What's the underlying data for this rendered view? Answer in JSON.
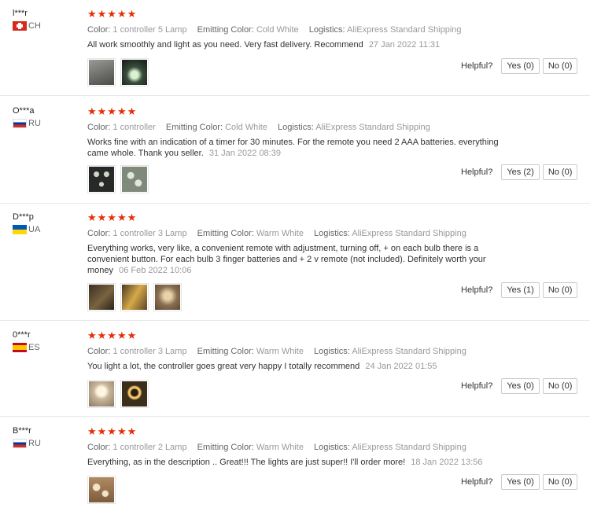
{
  "ui": {
    "helpful_label": "Helpful?",
    "stars": "★★★★★"
  },
  "reviews": [
    {
      "name": "l***r",
      "country": "CH",
      "color_label": "Color:",
      "color": "1 controller 5 Lamp",
      "emit_label": "Emitting Color:",
      "emit": "Cold White",
      "log_label": "Logistics:",
      "logistics": "AliExpress Standard Shipping",
      "text": "All work smoothly and light as you need. Very fast delivery. Recommend",
      "date": "27 Jan 2022 11:31",
      "yes": "Yes (0)",
      "no": "No (0)",
      "photos": [
        "#7d7d79",
        "#2b3a2d"
      ]
    },
    {
      "name": "O***a",
      "country": "RU",
      "color_label": "Color:",
      "color": "1 controller",
      "emit_label": "Emitting Color:",
      "emit": "Cold White",
      "log_label": "Logistics:",
      "logistics": "AliExpress Standard Shipping",
      "text": "Works fine with an indication of a timer for 30 minutes. For the remote you need 2 AAA batteries. everything came whole. Thank you seller.",
      "date": "31 Jan 2022 08:39",
      "yes": "Yes (2)",
      "no": "No (0)",
      "photos": [
        "#2c2f2e",
        "#8f9a8a"
      ]
    },
    {
      "name": "D***p",
      "country": "UA",
      "color_label": "Color:",
      "color": "1 controller 3 Lamp",
      "emit_label": "Emitting Color:",
      "emit": "Warm White",
      "log_label": "Logistics:",
      "logistics": "AliExpress Standard Shipping",
      "text": "Everything works, very like, a convenient remote with adjustment, turning off, + on each bulb there is a convenient button. For each bulb 3 finger batteries and + 2 v remote (not included). Definitely worth your money",
      "date": "06 Feb 2022 10:06",
      "yes": "Yes (1)",
      "no": "No (0)",
      "photos": [
        "#5a4a36",
        "#8a6a32",
        "#9a8160"
      ]
    },
    {
      "name": "0***r",
      "country": "ES",
      "color_label": "Color:",
      "color": "1 controller 3 Lamp",
      "emit_label": "Emitting Color:",
      "emit": "Warm White",
      "log_label": "Logistics:",
      "logistics": "AliExpress Standard Shipping",
      "text": "You light a lot, the controller goes great very happy I totally recommend",
      "date": "24 Jan 2022 01:55",
      "yes": "Yes (0)",
      "no": "No (0)",
      "photos": [
        "#c9b79a",
        "#3b2f1c"
      ]
    },
    {
      "name": "B***r",
      "country": "RU",
      "color_label": "Color:",
      "color": "1 controller 2 Lamp",
      "emit_label": "Emitting Color:",
      "emit": "Warm White",
      "log_label": "Logistics:",
      "logistics": "AliExpress Standard Shipping",
      "text": "Everything, as in the description .. Great!!! The lights are just super!! I'll order more!",
      "date": "18 Jan 2022 13:56",
      "yes": "Yes (0)",
      "no": "No (0)",
      "photos": [
        "#a27e5a"
      ]
    }
  ]
}
